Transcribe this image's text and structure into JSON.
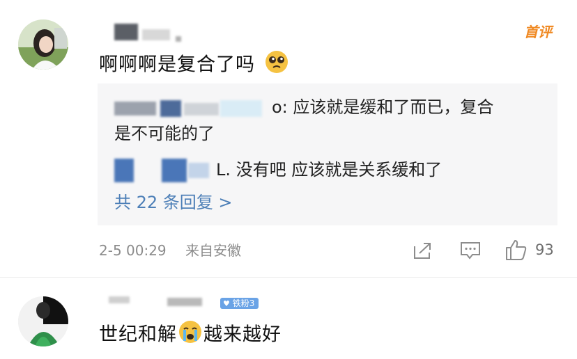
{
  "comment1": {
    "badge": "首评",
    "text": "啊啊啊是复合了吗",
    "emoji": "pleading-face-emoji",
    "reply1_tail": "o: 应该就是缓和了而已，复合",
    "reply1_line2": "是不可能的了",
    "reply2_tail": "L. 没有吧 应该就是关系缓和了",
    "more_replies": "共 22 条回复 >",
    "time": "2-5 00:29",
    "location": "来自安徽",
    "likes": "93"
  },
  "comment2": {
    "badge": "铁粉3",
    "text_before": "世纪和解",
    "emoji": "crying-face-emoji",
    "text_after": "越来越好"
  },
  "colors": {
    "badge_orange": "#f08a24",
    "link_blue": "#4d7fb7",
    "reply_bg": "#f6f6f7",
    "meta_gray": "#8c8c8c",
    "fan_badge_blue": "#6aa3e6"
  }
}
